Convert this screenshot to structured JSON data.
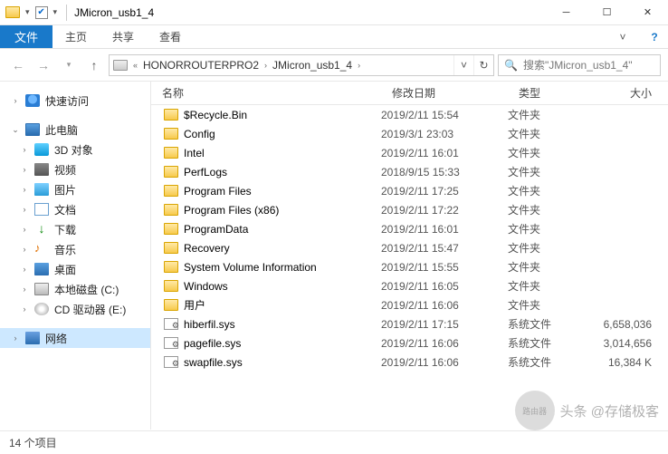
{
  "window": {
    "title": "JMicron_usb1_4"
  },
  "ribbon": {
    "file": "文件",
    "tabs": [
      "主页",
      "共享",
      "查看"
    ]
  },
  "address": {
    "segments": [
      "HONORROUTERPRO2",
      "JMicron_usb1_4"
    ]
  },
  "search": {
    "placeholder": "搜索\"JMicron_usb1_4\""
  },
  "nav": {
    "quick": "快速访问",
    "pc": "此电脑",
    "items": [
      {
        "label": "3D 对象",
        "icon": "ic-3d"
      },
      {
        "label": "视频",
        "icon": "ic-video"
      },
      {
        "label": "图片",
        "icon": "ic-pic"
      },
      {
        "label": "文档",
        "icon": "ic-doc"
      },
      {
        "label": "下载",
        "icon": "ic-dl"
      },
      {
        "label": "音乐",
        "icon": "ic-music"
      },
      {
        "label": "桌面",
        "icon": "ic-desk"
      },
      {
        "label": "本地磁盘 (C:)",
        "icon": "ic-drive"
      },
      {
        "label": "CD 驱动器 (E:)",
        "icon": "ic-cd"
      }
    ],
    "network": "网络"
  },
  "columns": {
    "name": "名称",
    "date": "修改日期",
    "type": "类型",
    "size": "大小"
  },
  "files": [
    {
      "name": "$Recycle.Bin",
      "date": "2019/2/11 15:54",
      "type": "文件夹",
      "size": "",
      "icon": "ic-folder-sm"
    },
    {
      "name": "Config",
      "date": "2019/3/1 23:03",
      "type": "文件夹",
      "size": "",
      "icon": "ic-folder-sm"
    },
    {
      "name": "Intel",
      "date": "2019/2/11 16:01",
      "type": "文件夹",
      "size": "",
      "icon": "ic-folder-sm"
    },
    {
      "name": "PerfLogs",
      "date": "2018/9/15 15:33",
      "type": "文件夹",
      "size": "",
      "icon": "ic-folder-sm"
    },
    {
      "name": "Program Files",
      "date": "2019/2/11 17:25",
      "type": "文件夹",
      "size": "",
      "icon": "ic-folder-sm"
    },
    {
      "name": "Program Files (x86)",
      "date": "2019/2/11 17:22",
      "type": "文件夹",
      "size": "",
      "icon": "ic-folder-sm"
    },
    {
      "name": "ProgramData",
      "date": "2019/2/11 16:01",
      "type": "文件夹",
      "size": "",
      "icon": "ic-folder-sm"
    },
    {
      "name": "Recovery",
      "date": "2019/2/11 15:47",
      "type": "文件夹",
      "size": "",
      "icon": "ic-folder-sm"
    },
    {
      "name": "System Volume Information",
      "date": "2019/2/11 15:55",
      "type": "文件夹",
      "size": "",
      "icon": "ic-folder-sm"
    },
    {
      "name": "Windows",
      "date": "2019/2/11 16:05",
      "type": "文件夹",
      "size": "",
      "icon": "ic-folder-sm"
    },
    {
      "name": "用户",
      "date": "2019/2/11 16:06",
      "type": "文件夹",
      "size": "",
      "icon": "ic-folder-sm"
    },
    {
      "name": "hiberfil.sys",
      "date": "2019/2/11 17:15",
      "type": "系统文件",
      "size": "6,658,036",
      "icon": "ic-sys"
    },
    {
      "name": "pagefile.sys",
      "date": "2019/2/11 16:06",
      "type": "系统文件",
      "size": "3,014,656",
      "icon": "ic-sys"
    },
    {
      "name": "swapfile.sys",
      "date": "2019/2/11 16:06",
      "type": "系统文件",
      "size": "16,384 K",
      "icon": "ic-sys"
    }
  ],
  "status": {
    "count": "14 个项目"
  },
  "watermark": {
    "logo": "路由器",
    "text": "头条 @存储极客"
  }
}
